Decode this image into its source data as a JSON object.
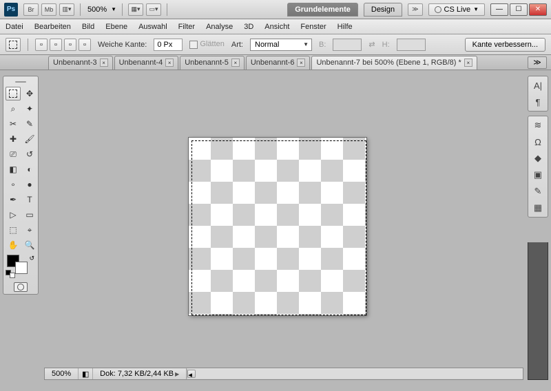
{
  "title_buttons": {
    "br": "Br",
    "mb": "Mb"
  },
  "zoom_display": "500%",
  "workspace": {
    "active": "Grundelemente",
    "other": "Design",
    "more": "≫",
    "cslive": "CS Live"
  },
  "menu": [
    "Datei",
    "Bearbeiten",
    "Bild",
    "Ebene",
    "Auswahl",
    "Filter",
    "Analyse",
    "3D",
    "Ansicht",
    "Fenster",
    "Hilfe"
  ],
  "options": {
    "feather_label": "Weiche Kante:",
    "feather_value": "0 Px",
    "antialias_label": "Glätten",
    "style_label": "Art:",
    "style_value": "Normal",
    "width_label": "B:",
    "height_label": "H:",
    "refine_btn": "Kante verbessern..."
  },
  "tabs": [
    {
      "label": "Unbenannt-3"
    },
    {
      "label": "Unbenannt-4"
    },
    {
      "label": "Unbenannt-5"
    },
    {
      "label": "Unbenannt-6"
    },
    {
      "label": "Unbenannt-7 bei 500% (Ebene 1, RGB/8) *"
    }
  ],
  "tabs_more": "≫",
  "status": {
    "zoom": "500%",
    "doc": "Dok: 7,32 KB/2,44 KB"
  }
}
